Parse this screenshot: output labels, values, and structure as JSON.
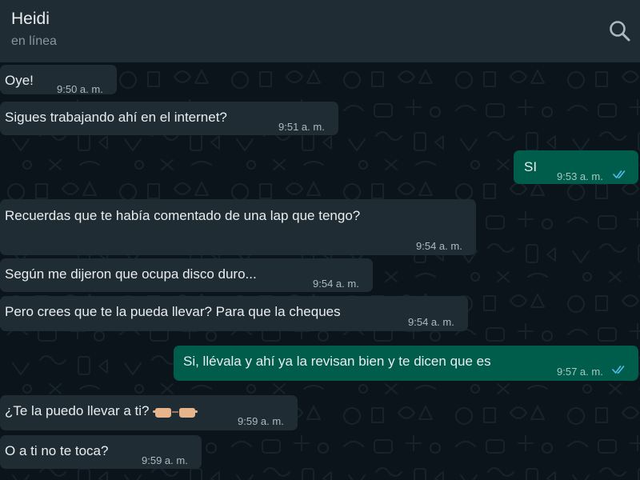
{
  "header": {
    "contact_name": "Heidi",
    "status": "en línea",
    "search_icon": "search-icon"
  },
  "colors": {
    "header_bg": "#1f2c34",
    "chat_bg": "#0b141a",
    "incoming_bubble": "#1f2c34",
    "outgoing_bubble": "#005c4b",
    "read_ticks": "#53bdeb"
  },
  "messages": [
    {
      "direction": "in",
      "text": "Oye!",
      "time": "9:50 a. m."
    },
    {
      "direction": "in",
      "text": "Sigues trabajando ahí en el internet?",
      "time": "9:51 a. m."
    },
    {
      "direction": "out",
      "text": "SI",
      "time": "9:53 a. m.",
      "status": "read"
    },
    {
      "direction": "in",
      "text": "Recuerdas que te había comentado de una lap que tengo?",
      "time": "9:54 a. m."
    },
    {
      "direction": "in",
      "text": "Según me dijeron que ocupa disco duro...",
      "time": "9:54 a. m."
    },
    {
      "direction": "in",
      "text": "Pero crees que te la pueda llevar? Para que la cheques",
      "time": "9:54 a. m."
    },
    {
      "direction": "out",
      "text": "Si, llévala y ahí  ya la revisan bien y te dicen que es",
      "time": "9:57 a. m.",
      "status": "read"
    },
    {
      "direction": "in",
      "text": "¿Te la puedo llevar a ti?",
      "time": "9:59 a. m.",
      "emoji": "pointing-hands-emoji"
    },
    {
      "direction": "in",
      "text": "O a ti no te toca?",
      "time": "9:59 a. m."
    }
  ]
}
